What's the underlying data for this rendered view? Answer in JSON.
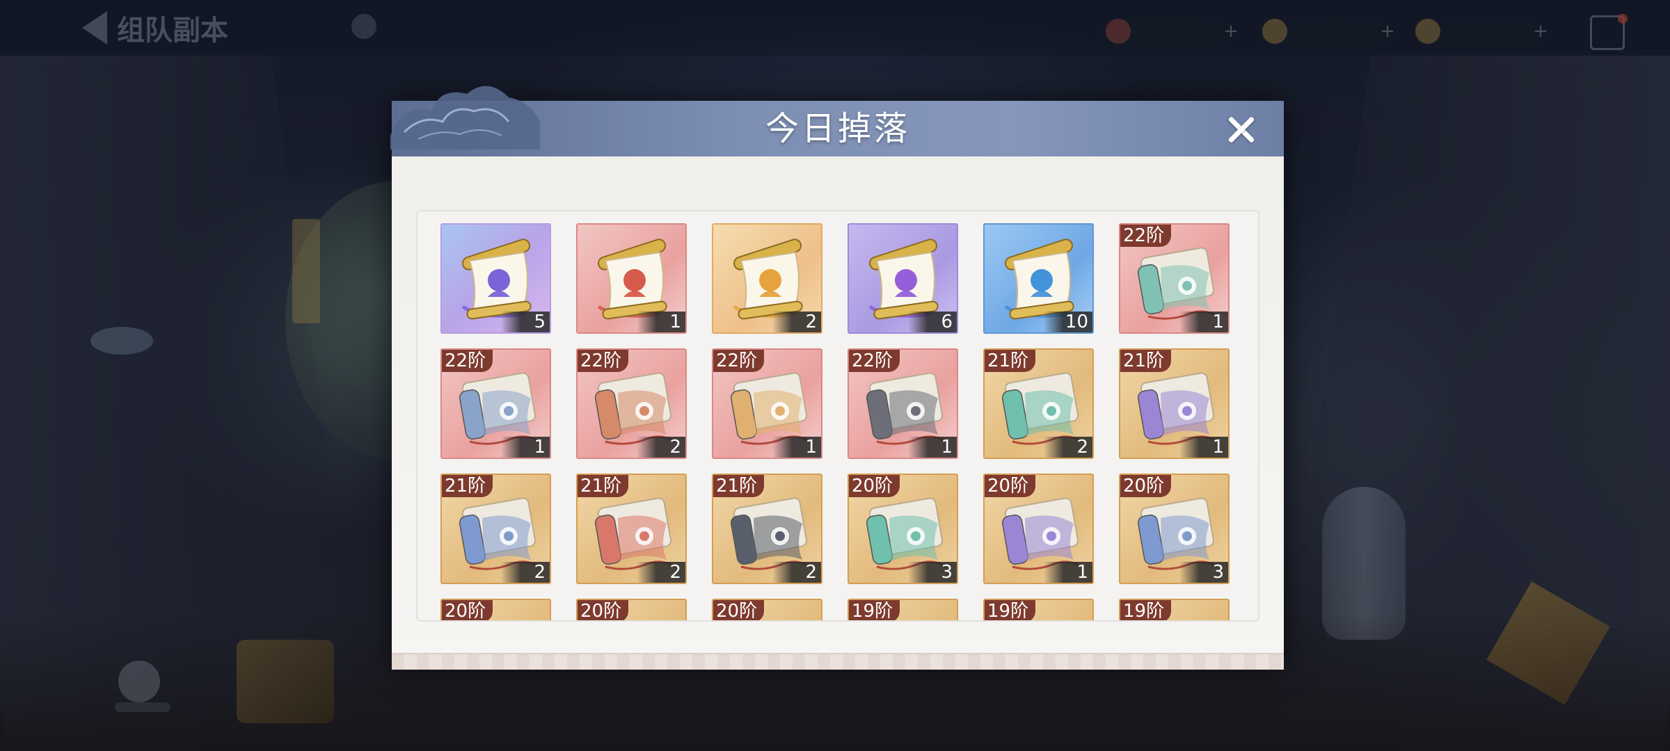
{
  "top_bar": {
    "back_label": "组队副本",
    "currencies": [
      {
        "icon": "gem-icon"
      },
      {
        "icon": "gold-coin-icon"
      },
      {
        "icon": "gold-ingot-icon"
      }
    ]
  },
  "modal": {
    "title": "今日掉落",
    "close_icon": "close-icon"
  },
  "items": [
    {
      "tier": "",
      "count": "5",
      "rarity": "purple",
      "icon": "skill-scroll-icon",
      "color": "#6a54d6"
    },
    {
      "tier": "",
      "count": "1",
      "rarity": "red",
      "icon": "skill-scroll-icon",
      "color": "#d24a3a"
    },
    {
      "tier": "",
      "count": "2",
      "rarity": "orange",
      "icon": "skill-scroll-icon",
      "color": "#e39a2a"
    },
    {
      "tier": "",
      "count": "6",
      "rarity": "violet",
      "icon": "skill-scroll-icon",
      "color": "#8a4fd8"
    },
    {
      "tier": "",
      "count": "10",
      "rarity": "blue",
      "icon": "skill-scroll-icon",
      "color": "#2f88d8"
    },
    {
      "tier": "22阶",
      "count": "1",
      "rarity": "red",
      "icon": "manual-scroll-icon",
      "color": "#7fc2b3"
    },
    {
      "tier": "22阶",
      "count": "1",
      "rarity": "red",
      "icon": "manual-scroll-icon",
      "color": "#8aa3c8"
    },
    {
      "tier": "22阶",
      "count": "2",
      "rarity": "red",
      "icon": "manual-scroll-icon",
      "color": "#d68a6a"
    },
    {
      "tier": "22阶",
      "count": "1",
      "rarity": "red",
      "icon": "manual-scroll-icon",
      "color": "#e0b070"
    },
    {
      "tier": "22阶",
      "count": "1",
      "rarity": "red",
      "icon": "manual-scroll-icon",
      "color": "#6c6f78"
    },
    {
      "tier": "21阶",
      "count": "2",
      "rarity": "tan",
      "icon": "manual-scroll-icon",
      "color": "#6fc0ad"
    },
    {
      "tier": "21阶",
      "count": "1",
      "rarity": "tan",
      "icon": "manual-scroll-icon",
      "color": "#9b86d6"
    },
    {
      "tier": "21阶",
      "count": "2",
      "rarity": "tan",
      "icon": "manual-scroll-icon",
      "color": "#7f9ad0"
    },
    {
      "tier": "21阶",
      "count": "2",
      "rarity": "tan",
      "icon": "manual-scroll-icon",
      "color": "#d9786a"
    },
    {
      "tier": "21阶",
      "count": "2",
      "rarity": "tan",
      "icon": "manual-scroll-icon",
      "color": "#5a5f6c"
    },
    {
      "tier": "20阶",
      "count": "3",
      "rarity": "tan",
      "icon": "manual-scroll-icon",
      "color": "#6fc0ad"
    },
    {
      "tier": "20阶",
      "count": "1",
      "rarity": "tan",
      "icon": "manual-scroll-icon",
      "color": "#9b86d6"
    },
    {
      "tier": "20阶",
      "count": "3",
      "rarity": "tan",
      "icon": "manual-scroll-icon",
      "color": "#7f9ad0"
    },
    {
      "tier": "20阶",
      "count": "",
      "rarity": "tan",
      "icon": "manual-scroll-icon",
      "color": "#d9786a"
    },
    {
      "tier": "20阶",
      "count": "",
      "rarity": "tan",
      "icon": "manual-scroll-icon",
      "color": "#7f9ad0"
    },
    {
      "tier": "20阶",
      "count": "",
      "rarity": "tan",
      "icon": "manual-scroll-icon",
      "color": "#6fc0ad"
    },
    {
      "tier": "19阶",
      "count": "",
      "rarity": "tan",
      "icon": "manual-scroll-icon",
      "color": "#9b86d6"
    },
    {
      "tier": "19阶",
      "count": "",
      "rarity": "tan",
      "icon": "manual-scroll-icon",
      "color": "#7f9ad0"
    },
    {
      "tier": "19阶",
      "count": "",
      "rarity": "tan",
      "icon": "manual-scroll-icon",
      "color": "#d9786a"
    }
  ]
}
